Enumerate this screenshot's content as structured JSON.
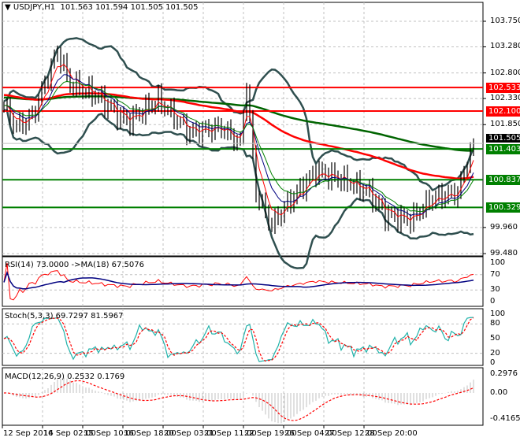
{
  "header": {
    "symbol": "USDJPY,H1",
    "ohlc": "101.563 101.594 101.505 101.505"
  },
  "price_axis": {
    "labels": [
      "103.750",
      "103.280",
      "102.800",
      "102.330",
      "101.850",
      "99.960",
      "99.480"
    ],
    "values": [
      103.75,
      103.28,
      102.8,
      102.33,
      101.85,
      99.96,
      99.48
    ]
  },
  "levels": [
    {
      "label": "102.533",
      "value": 102.533,
      "color": "#ff0000"
    },
    {
      "label": "102.100",
      "value": 102.1,
      "color": "#ff0000"
    },
    {
      "label": "101.403",
      "value": 101.403,
      "color": "#008000"
    },
    {
      "label": "100.837",
      "value": 100.837,
      "color": "#008000"
    },
    {
      "label": "100.329",
      "value": 100.329,
      "color": "#008000"
    }
  ],
  "current_price": {
    "label": "101.505",
    "value": 101.505
  },
  "rsi": {
    "title": "RSI(14) 73.0000  ->MA(18) 67.5076",
    "axis": [
      "100",
      "70",
      "30",
      "0"
    ]
  },
  "stoch": {
    "title": "Stoch(5,3,3) 69.7297 81.5967",
    "axis": [
      "100",
      "80",
      "50",
      "20",
      "0"
    ]
  },
  "macd": {
    "title": "MACD(12,26,9) 0.2532 0.1769",
    "axis": [
      "0.2976",
      "0.00",
      "-0.4165"
    ]
  },
  "time_axis": [
    "12 Sep 2016",
    "14 Sep 02:00",
    "15 Sep 10:00",
    "16 Sep 18:00",
    "20 Sep 03:00",
    "21 Sep 11:00",
    "22 Sep 19:00",
    "26 Sep 04:00",
    "27 Sep 12:00",
    "28 Sep 20:00"
  ],
  "colors": {
    "bull": "#000000",
    "ma_fast": "#ff0000",
    "ma_slow": "#006400",
    "bands": "#2f4f4f",
    "rsi": "#ff0000",
    "rsi_ma": "#000080",
    "stoch_main": "#20b2aa",
    "stoch_signal": "#ff0000",
    "macd_hist": "#c0c0c0"
  },
  "chart_data": {
    "type": "line",
    "title": "USDJPY,H1",
    "price_path": [
      [
        0,
        102.2
      ],
      [
        4,
        101.8
      ],
      [
        9,
        102.0
      ],
      [
        17,
        103.2
      ],
      [
        21,
        102.6
      ],
      [
        29,
        102.4
      ],
      [
        39,
        101.9
      ],
      [
        49,
        102.3
      ],
      [
        59,
        101.7
      ],
      [
        69,
        101.8
      ],
      [
        75,
        101.5
      ],
      [
        77,
        102.6
      ],
      [
        80,
        100.6
      ],
      [
        85,
        100.0
      ],
      [
        90,
        100.4
      ],
      [
        99,
        101.0
      ],
      [
        109,
        100.8
      ],
      [
        116,
        100.6
      ],
      [
        121,
        100.2
      ],
      [
        129,
        100.1
      ],
      [
        136,
        100.5
      ],
      [
        144,
        100.6
      ],
      [
        149,
        101.55
      ]
    ],
    "ylim": [
      99.48,
      103.75
    ]
  }
}
